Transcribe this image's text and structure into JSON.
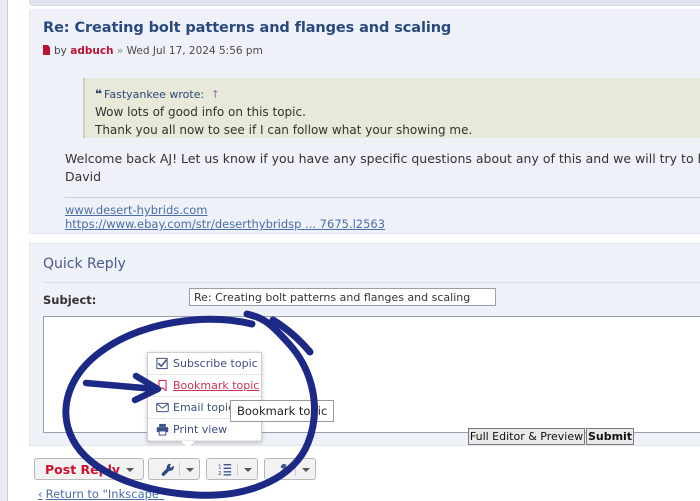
{
  "post": {
    "title": "Re: Creating bolt patterns and flanges and scaling",
    "by_label": "by",
    "author": "adbuch",
    "separator": "»",
    "timestamp": "Wed Jul 17, 2024 5:56 pm",
    "quote": {
      "author": "Fastyankee",
      "wrote_label": "wrote:",
      "jump_arrow": "↑",
      "line1": "Wow lots of good info on this topic.",
      "line2": "Thank you all now to see if I can follow what your showing me."
    },
    "body_line1": "Welcome back AJ! Let us know if you have any specific questions about any of this and we will try to help.",
    "body_line2": "David",
    "signature": {
      "link1": "www.desert-hybrids.com",
      "link2": "https://www.ebay.com/str/deserthybridsp ... 7675.l2563"
    }
  },
  "quick_reply": {
    "heading": "Quick Reply",
    "subject_label": "Subject:",
    "subject_value": "Re: Creating bolt patterns and flanges and scaling",
    "message_value": "",
    "message_placeholder": "",
    "full_editor_label": "Full Editor & Preview",
    "submit_label": "Submit"
  },
  "toolbar": {
    "post_reply_label": "Post Reply",
    "tools_icon": "wrench-icon",
    "sort_icon": "sort-ascending-icon",
    "moderation_icon": "hammer-icon",
    "caret_icon": "chevron-down-icon"
  },
  "dropdown": {
    "items": [
      {
        "label": "Subscribe topic",
        "icon": "checkbox-checked-icon"
      },
      {
        "label": "Bookmark topic",
        "icon": "bookmark-icon"
      },
      {
        "label": "Email topic",
        "icon": "envelope-icon"
      },
      {
        "label": "Print view",
        "icon": "printer-icon"
      }
    ]
  },
  "tooltip": {
    "text": "Bookmark topic"
  },
  "footer": {
    "return_link": "Return to \"Inkscape\"",
    "chevron": "‹"
  },
  "colors": {
    "panel_bg": "#eef1f7",
    "quote_bg": "#e8e9d8",
    "title_blue": "#2a4a7d",
    "author_red": "#bb1133",
    "link_blue": "#4a6fa8",
    "bookmark_red": "#cc3355",
    "post_reply_red": "#cc1133",
    "annotation_blue": "#1c2a86"
  }
}
